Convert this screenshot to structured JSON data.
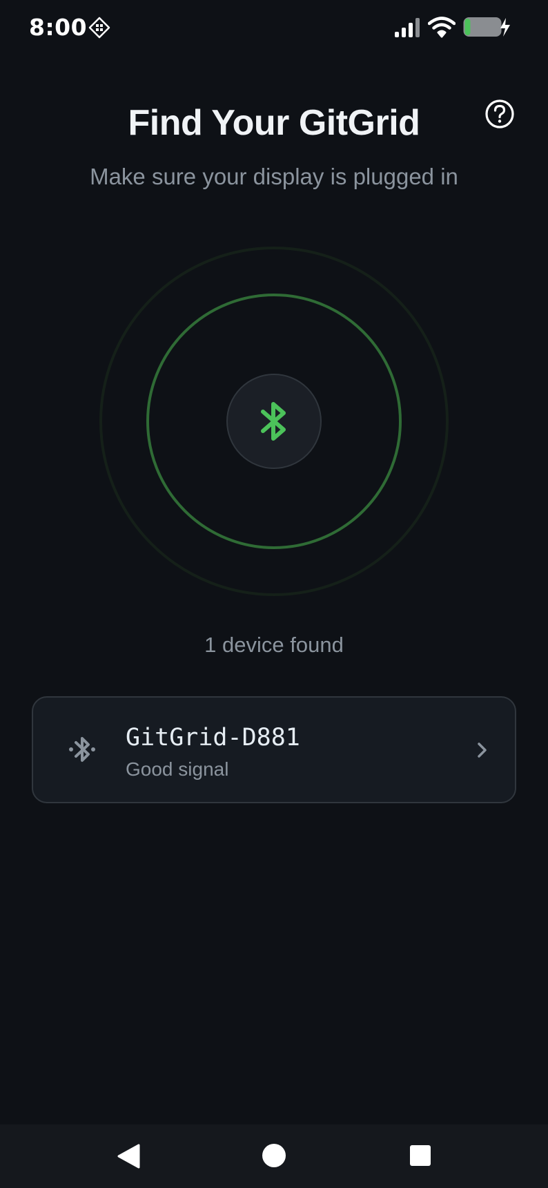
{
  "status_bar": {
    "time": "8:00"
  },
  "header": {
    "title": "Find Your GitGrid",
    "subtitle": "Make sure your display is plugged in"
  },
  "scan": {
    "devices_found_label": "1 device found"
  },
  "devices": [
    {
      "name": "GitGrid-D881",
      "signal": "Good signal"
    }
  ],
  "icons": {
    "help": "help-circle-icon",
    "bluetooth": "bluetooth-icon",
    "chevron": "chevron-right-icon",
    "nav_back": "back-triangle-icon",
    "nav_home": "home-circle-icon",
    "nav_recents": "recents-square-icon"
  },
  "colors": {
    "background": "#0e1116",
    "accent": "#4cc25a",
    "card_background": "#161b22",
    "card_border": "#30363d",
    "muted_text": "#8b949e"
  }
}
